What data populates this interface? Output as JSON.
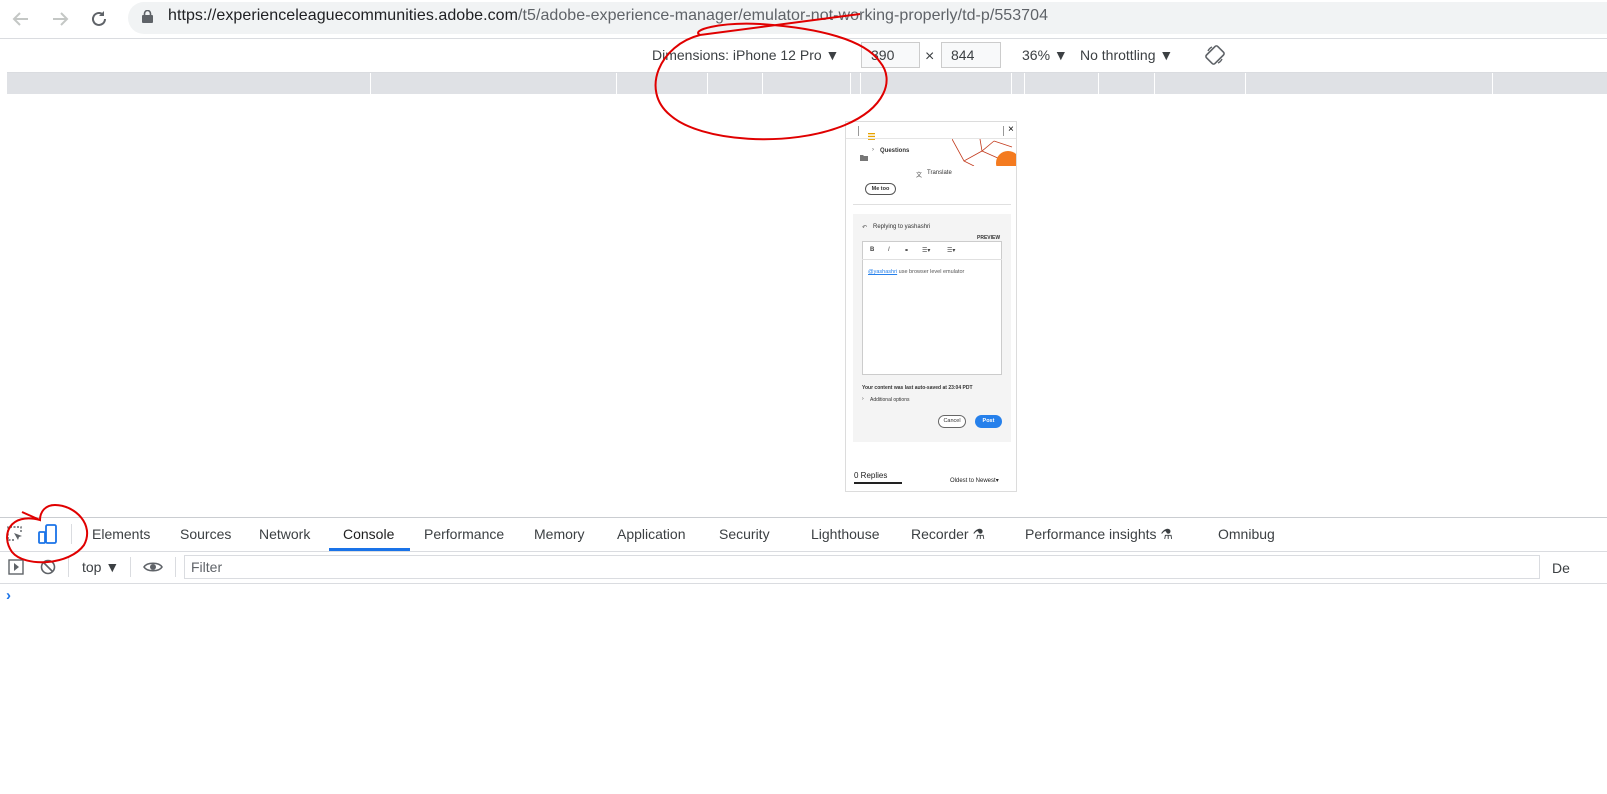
{
  "browser": {
    "url_host": "https://experienceleaguecommunities.adobe.com",
    "url_path": "/t5/adobe-experience-manager/emulator-not-working-properly/td-p/553704"
  },
  "device_toolbar": {
    "dimensions_label": "Dimensions: iPhone 12 Pro",
    "width": "390",
    "height": "844",
    "times": "×",
    "zoom": "36%",
    "throttling": "No throttling"
  },
  "phone": {
    "breadcrumb": "Questions",
    "translate_label": "Translate",
    "me_too": "Me too",
    "replying_label": "Replying to yashashri",
    "preview": "PREVIEW",
    "editor_mention": "@yashashri",
    "editor_text": " use browser level emulator",
    "autosave": "Your content was last auto-saved at 23:04 PDT",
    "additional_options": "Additional options",
    "cancel": "Cancel",
    "post": "Post",
    "replies": "0 Replies",
    "sort": "Oldest to Newest"
  },
  "devtools": {
    "tabs": [
      "Elements",
      "Sources",
      "Network",
      "Console",
      "Performance",
      "Memory",
      "Application",
      "Security",
      "Lighthouse",
      "Recorder",
      "Performance insights",
      "Omnibug"
    ],
    "context": "top",
    "filter_placeholder": "Filter",
    "default_levels_partial": "De",
    "prompt": "›"
  },
  "colors": {
    "accent": "#1a73e8",
    "annotation": "#e00000",
    "post_button": "#2680eb"
  }
}
